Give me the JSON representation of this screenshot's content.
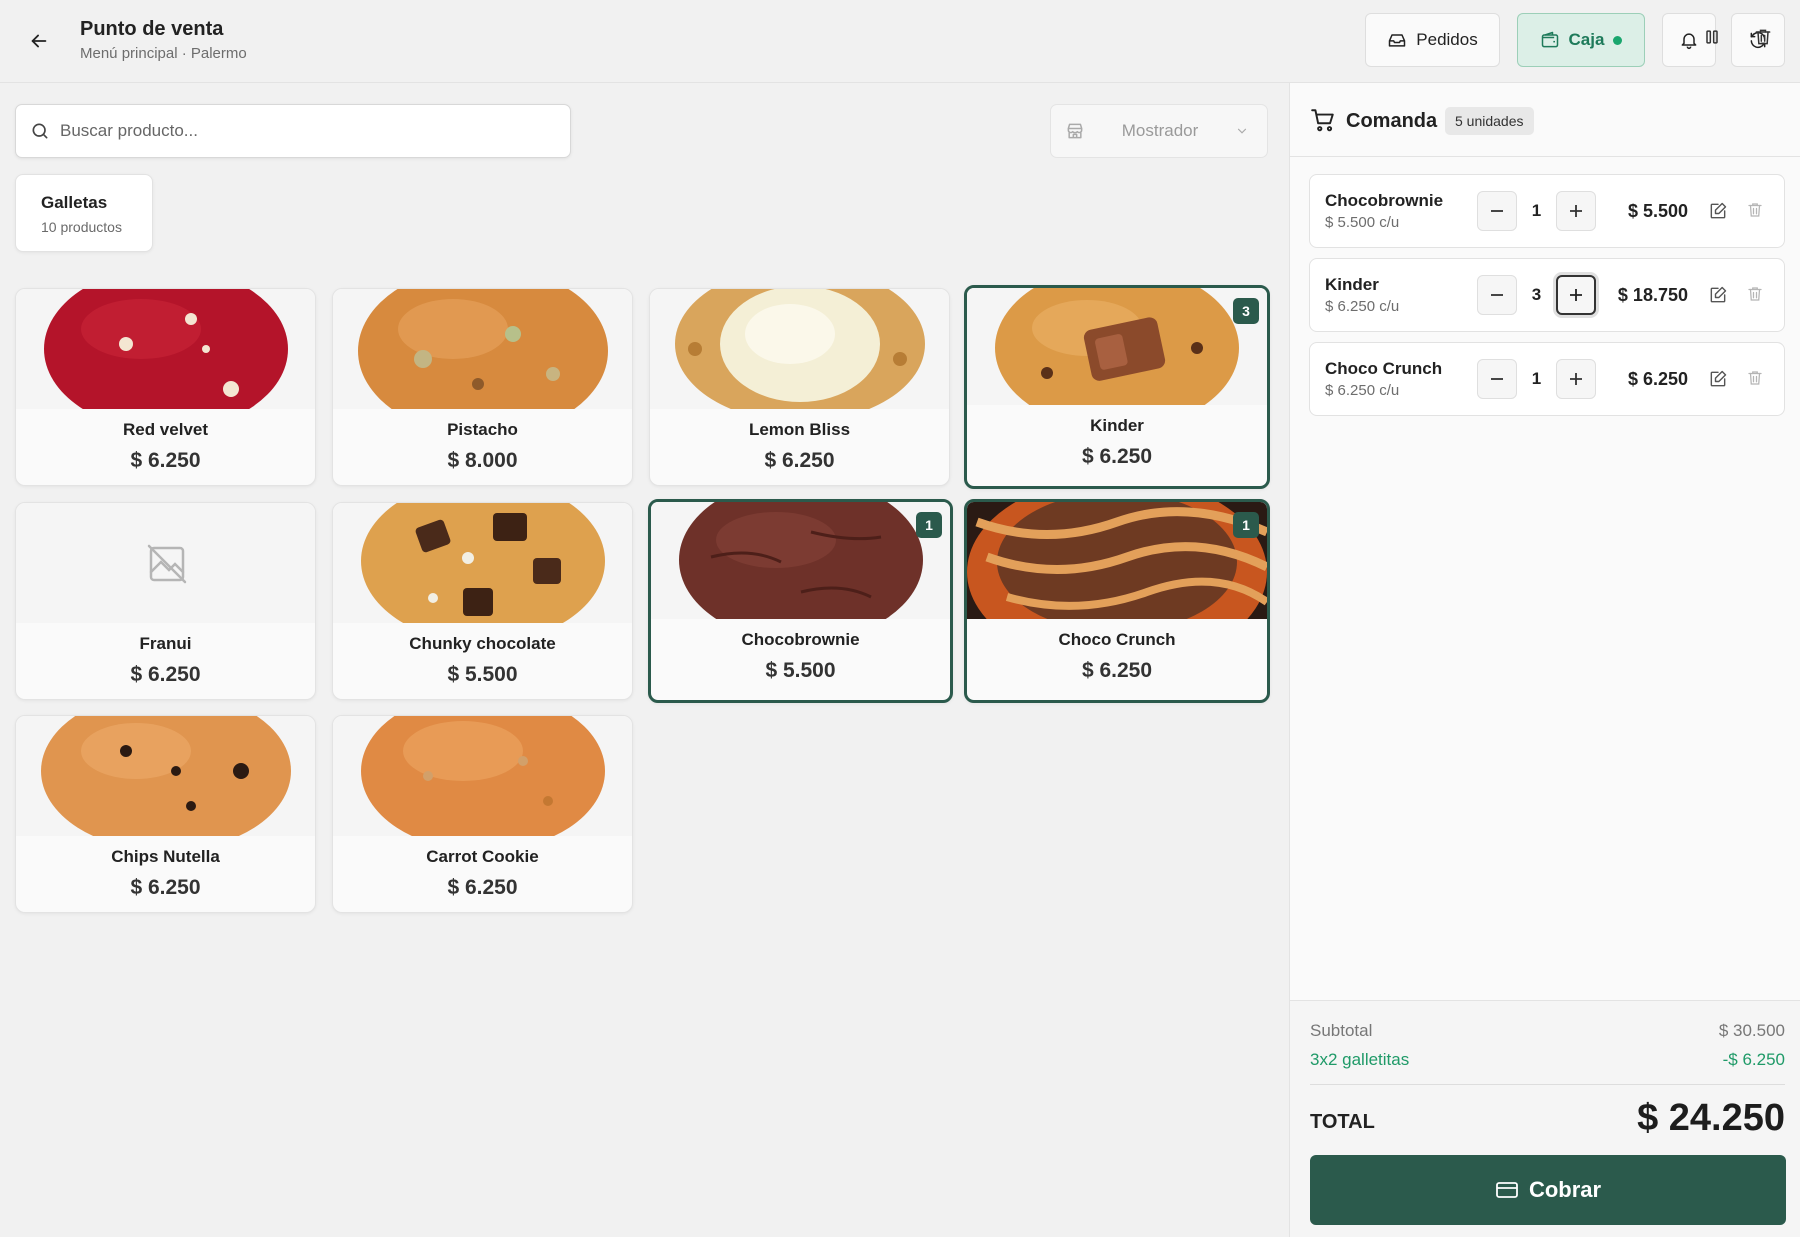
{
  "header": {
    "title": "Punto de venta",
    "subtitle": "Menú principal · Palermo",
    "pedidos_label": "Pedidos",
    "caja_label": "Caja"
  },
  "search": {
    "placeholder": "Buscar producto..."
  },
  "location": {
    "label": "Mostrador"
  },
  "category": {
    "name": "Galletas",
    "count": "10 productos"
  },
  "products": [
    {
      "name": "Red velvet",
      "price": "$ 6.250",
      "image": "red-velvet-cookie"
    },
    {
      "name": "Pistacho",
      "price": "$ 8.000",
      "image": "pistachio-cookie"
    },
    {
      "name": "Lemon Bliss",
      "price": "$ 6.250",
      "image": "lemon-cream-cookie"
    },
    {
      "name": "Kinder",
      "price": "$ 6.250",
      "image": "kinder-cookie",
      "badge": "3",
      "selected": true
    },
    {
      "name": "Franui",
      "price": "$ 6.250",
      "image": "no-image-icon"
    },
    {
      "name": "Chunky chocolate",
      "price": "$ 5.500",
      "image": "chunky-chocolate-cookie"
    },
    {
      "name": "Chocobrownie",
      "price": "$ 5.500",
      "image": "chocobrownie-cookie",
      "badge": "1",
      "selected": true
    },
    {
      "name": "Choco Crunch",
      "price": "$ 6.250",
      "image": "caramel-crunch-cookie",
      "badge": "1",
      "selected": true
    },
    {
      "name": "Chips Nutella",
      "price": "$ 6.250",
      "image": "chips-cookie"
    },
    {
      "name": "Carrot Cookie",
      "price": "$ 6.250",
      "image": "carrot-cookie"
    }
  ],
  "order": {
    "title": "Comanda",
    "units": "5 unidades",
    "lines": [
      {
        "name": "Chocobrownie",
        "unit_price": "$ 5.500 c/u",
        "qty": "1",
        "total": "$ 5.500"
      },
      {
        "name": "Kinder",
        "unit_price": "$ 6.250 c/u",
        "qty": "3",
        "total": "$ 18.750"
      },
      {
        "name": "Choco Crunch",
        "unit_price": "$ 6.250 c/u",
        "qty": "1",
        "total": "$ 6.250"
      }
    ],
    "subtotal_label": "Subtotal",
    "subtotal_value": "$ 30.500",
    "discount_label": "3x2 galletitas",
    "discount_value": "-$ 6.250",
    "total_label": "TOTAL",
    "total_value": "$ 24.250",
    "checkout_label": "Cobrar"
  },
  "colors": {
    "brand": "#2b5a4c",
    "caja_bg": "#dcefe7",
    "discount": "#1f9a68"
  }
}
